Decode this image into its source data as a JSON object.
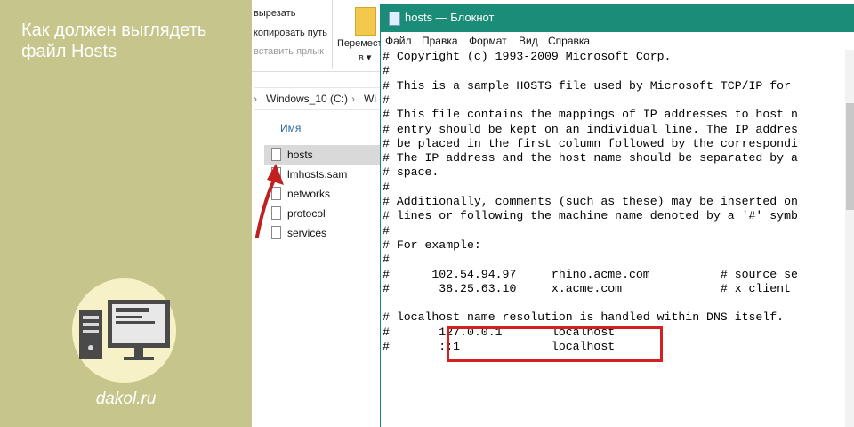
{
  "promo": {
    "title": "Как должен выглядеть файл Hosts",
    "site": "dakol.ru"
  },
  "explorer": {
    "ribbon": {
      "cut": "вырезать",
      "copy_path": "копировать путь",
      "paste_shortcut": "вставить ярлык",
      "move_to": "Перемести",
      "move_to_suffix": "в ▾"
    },
    "address": {
      "drive": "Windows_10 (C:)",
      "next_segment": "Wi"
    },
    "column_name": "Имя",
    "files": [
      {
        "name": "hosts",
        "selected": true
      },
      {
        "name": "lmhosts.sam",
        "selected": false
      },
      {
        "name": "networks",
        "selected": false
      },
      {
        "name": "protocol",
        "selected": false
      },
      {
        "name": "services",
        "selected": false
      }
    ]
  },
  "notepad": {
    "title": "hosts — Блокнот",
    "menu": [
      "Файл",
      "Правка",
      "Формат",
      "Вид",
      "Справка"
    ],
    "lines": [
      "# Copyright (c) 1993-2009 Microsoft Corp.",
      "#",
      "# This is a sample HOSTS file used by Microsoft TCP/IP for",
      "#",
      "# This file contains the mappings of IP addresses to host n",
      "# entry should be kept on an individual line. The IP addres",
      "# be placed in the first column followed by the correspondi",
      "# The IP address and the host name should be separated by a",
      "# space.",
      "#",
      "# Additionally, comments (such as these) may be inserted on",
      "# lines or following the machine name denoted by a '#' symb",
      "#",
      "# For example:",
      "#",
      "#      102.54.94.97     rhino.acme.com          # source se",
      "#       38.25.63.10     x.acme.com              # x client",
      "",
      "# localhost name resolution is handled within DNS itself.",
      "#       127.0.0.1       localhost",
      "#       ::1             localhost"
    ]
  },
  "colors": {
    "panel_bg": "#c6c68c",
    "notepad_title_bg": "#1a8c78",
    "highlight": "#d42020",
    "arrow": "#c0201e"
  }
}
